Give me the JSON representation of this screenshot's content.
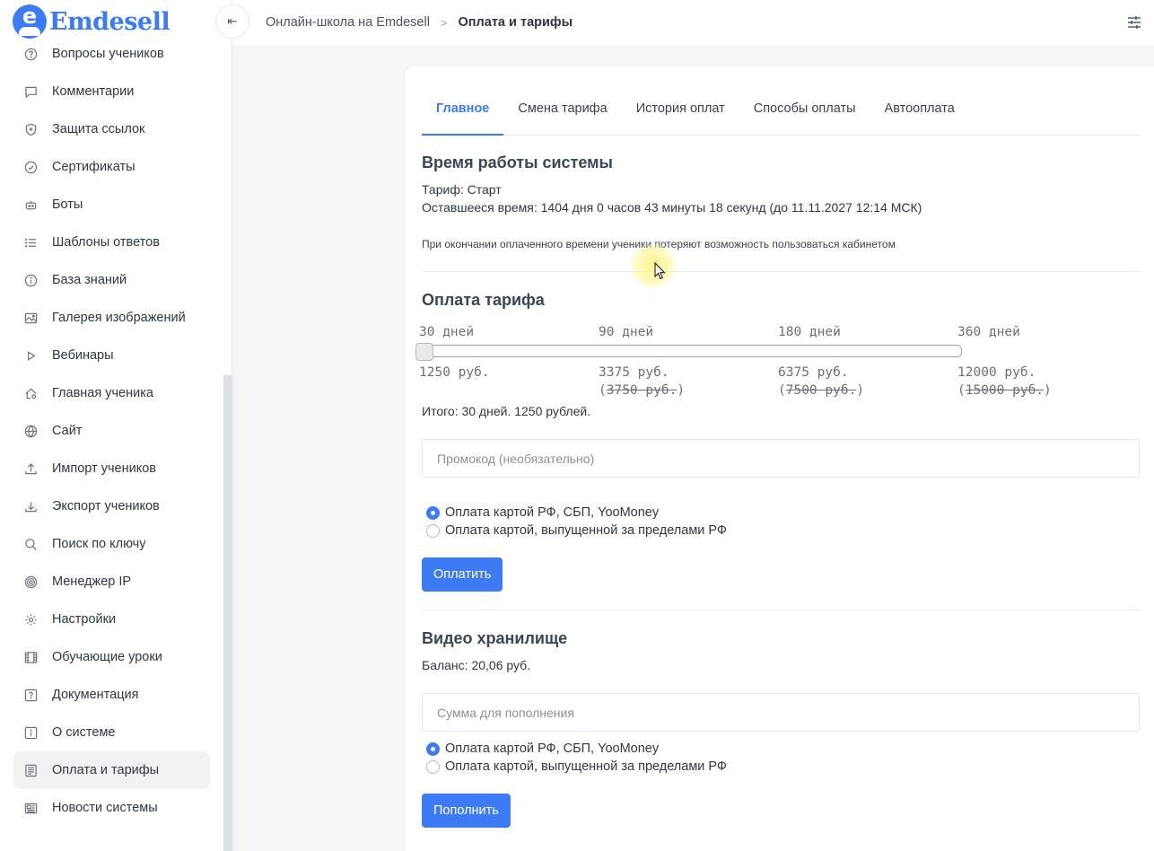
{
  "brand": {
    "name": "Emdesell",
    "badge_letter": "e",
    "color": "#3d7bf5"
  },
  "sidebar": {
    "items": [
      {
        "label": "Вопросы учеников",
        "icon": "question-circle-icon"
      },
      {
        "label": "Комментарии",
        "icon": "comment-icon"
      },
      {
        "label": "Защита ссылок",
        "icon": "shield-icon"
      },
      {
        "label": "Сертификаты",
        "icon": "check-circle-icon"
      },
      {
        "label": "Боты",
        "icon": "robot-icon"
      },
      {
        "label": "Шаблоны ответов",
        "icon": "list-icon"
      },
      {
        "label": "База знаний",
        "icon": "info-circle-icon"
      },
      {
        "label": "Галерея изображений",
        "icon": "image-icon"
      },
      {
        "label": "Вебинары",
        "icon": "play-icon"
      },
      {
        "label": "Главная ученика",
        "icon": "home-gear-icon"
      },
      {
        "label": "Сайт",
        "icon": "globe-icon"
      },
      {
        "label": "Импорт учеников",
        "icon": "upload-icon"
      },
      {
        "label": "Экспорт учеников",
        "icon": "download-icon"
      },
      {
        "label": "Поиск по ключу",
        "icon": "search-icon"
      },
      {
        "label": "Менеджер IP",
        "icon": "target-icon"
      },
      {
        "label": "Настройки",
        "icon": "gear-icon"
      },
      {
        "label": "Обучающие уроки",
        "icon": "film-icon"
      },
      {
        "label": "Документация",
        "icon": "help-square-icon"
      },
      {
        "label": "О системе",
        "icon": "info-square-icon"
      },
      {
        "label": "Оплата и тарифы",
        "icon": "receipt-icon",
        "active": true
      },
      {
        "label": "Новости системы",
        "icon": "newspaper-icon"
      }
    ]
  },
  "header": {
    "collapse_icon": "collapse-left-icon",
    "breadcrumb_root": "Онлайн-школа на Emdesell",
    "breadcrumb_separator": ">",
    "breadcrumb_current": "Оплата и тарифы",
    "settings_icon": "sliders-icon"
  },
  "tabs": [
    {
      "label": "Главное",
      "active": true
    },
    {
      "label": "Смена тарифа"
    },
    {
      "label": "История оплат"
    },
    {
      "label": "Способы оплаты"
    },
    {
      "label": "Автооплата"
    }
  ],
  "system_time": {
    "title": "Время работы системы",
    "tariff": "Тариф: Старт",
    "remaining": "Оставшееся время: 1404 дня 0 часов 43 минуты 18 секунд (до 11.11.2027 12:14 МСК)",
    "note": "При окончании оплаченного времени ученики потеряют возможность пользоваться кабинетом"
  },
  "tariff_payment": {
    "title": "Оплата тарифа",
    "options": [
      {
        "period": "30 дней",
        "price": "1250 руб.",
        "old_price": ""
      },
      {
        "period": "90 дней",
        "price": "3375 руб.",
        "old_price": "3750 руб."
      },
      {
        "period": "180 дней",
        "price": "6375 руб.",
        "old_price": "7500 руб."
      },
      {
        "period": "360 дней",
        "price": "12000 руб.",
        "old_price": "15000 руб."
      }
    ],
    "selected_index": 0,
    "total": "Итого: 30 дней. 1250 рублей.",
    "promo_placeholder": "Промокод (необязательно)",
    "methods": [
      {
        "label": "Оплата картой РФ, СБП, YooMoney",
        "checked": true
      },
      {
        "label": "Оплата картой, выпущенной за пределами РФ",
        "checked": false
      }
    ],
    "pay_button": "Оплатить"
  },
  "video_storage": {
    "title": "Видео хранилище",
    "balance": "Баланс: 20,06 руб.",
    "amount_placeholder": "Сумма для пополнения",
    "methods": [
      {
        "label": "Оплата картой РФ, СБП, YooMoney",
        "checked": true
      },
      {
        "label": "Оплата картой, выпущенной за пределами РФ",
        "checked": false
      }
    ],
    "topup_button": "Пополнить"
  }
}
